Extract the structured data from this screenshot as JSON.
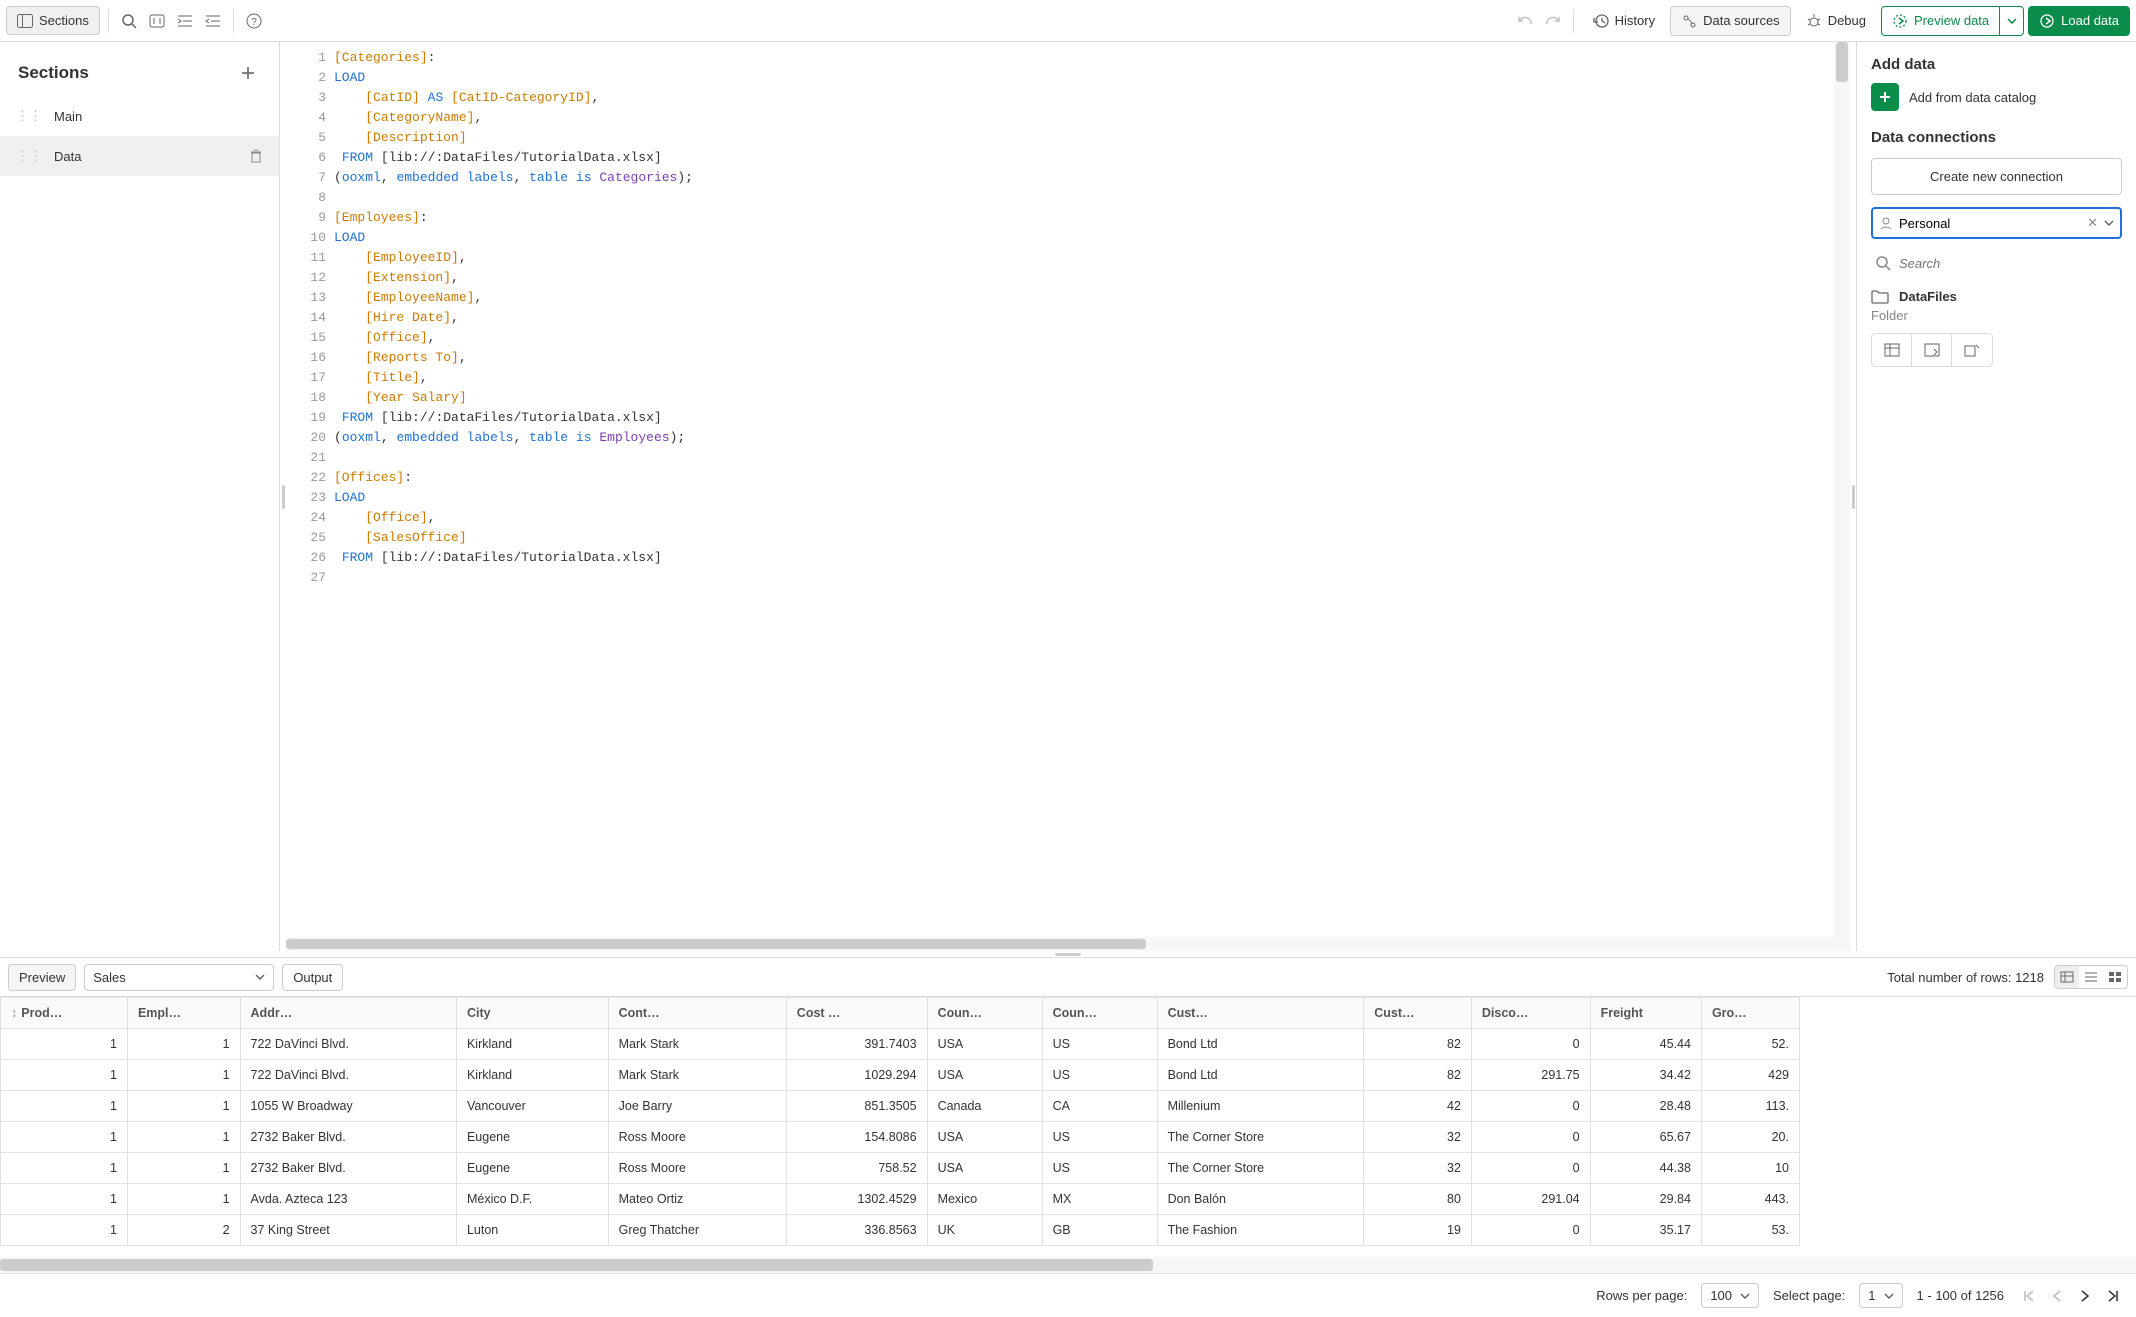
{
  "toolbar": {
    "sections_label": "Sections",
    "history_label": "History",
    "data_sources_label": "Data sources",
    "debug_label": "Debug",
    "preview_data_label": "Preview data",
    "load_data_label": "Load data"
  },
  "sidebar": {
    "title": "Sections",
    "items": [
      {
        "label": "Main",
        "active": false
      },
      {
        "label": "Data",
        "active": true
      }
    ]
  },
  "editor": {
    "lines": [
      {
        "n": 1,
        "segs": [
          [
            "[Categories]",
            "or"
          ],
          [
            ":",
            ""
          ]
        ]
      },
      {
        "n": 2,
        "segs": [
          [
            "LOAD",
            "bl"
          ]
        ]
      },
      {
        "n": 3,
        "segs": [
          [
            "    ",
            ""
          ],
          [
            "[CatID]",
            "or"
          ],
          [
            " ",
            ""
          ],
          [
            "AS",
            "bl"
          ],
          [
            " ",
            ""
          ],
          [
            "[CatID-CategoryID]",
            "or"
          ],
          [
            ",",
            ""
          ]
        ]
      },
      {
        "n": 4,
        "segs": [
          [
            "    ",
            ""
          ],
          [
            "[CategoryName]",
            "or"
          ],
          [
            ",",
            ""
          ]
        ]
      },
      {
        "n": 5,
        "segs": [
          [
            "    ",
            ""
          ],
          [
            "[Description]",
            "or"
          ]
        ]
      },
      {
        "n": 6,
        "segs": [
          [
            " ",
            ""
          ],
          [
            "FROM",
            "bl"
          ],
          [
            " [lib://:DataFiles/TutorialData.xlsx]",
            ""
          ]
        ]
      },
      {
        "n": 7,
        "segs": [
          [
            "(",
            ""
          ],
          [
            "ooxml",
            "bl"
          ],
          [
            ", ",
            ""
          ],
          [
            "embedded",
            "bl"
          ],
          [
            " ",
            ""
          ],
          [
            "labels",
            "bl"
          ],
          [
            ", ",
            ""
          ],
          [
            "table",
            "bl"
          ],
          [
            " ",
            ""
          ],
          [
            "is",
            "bl"
          ],
          [
            " ",
            ""
          ],
          [
            "Categories",
            "pu"
          ],
          [
            ");",
            ""
          ]
        ]
      },
      {
        "n": 8,
        "segs": [
          [
            "",
            ""
          ]
        ]
      },
      {
        "n": 9,
        "segs": [
          [
            "[Employees]",
            "or"
          ],
          [
            ":",
            ""
          ]
        ]
      },
      {
        "n": 10,
        "segs": [
          [
            "LOAD",
            "bl"
          ]
        ]
      },
      {
        "n": 11,
        "segs": [
          [
            "    ",
            ""
          ],
          [
            "[EmployeeID]",
            "or"
          ],
          [
            ",",
            ""
          ]
        ]
      },
      {
        "n": 12,
        "segs": [
          [
            "    ",
            ""
          ],
          [
            "[Extension]",
            "or"
          ],
          [
            ",",
            ""
          ]
        ]
      },
      {
        "n": 13,
        "segs": [
          [
            "    ",
            ""
          ],
          [
            "[EmployeeName]",
            "or"
          ],
          [
            ",",
            ""
          ]
        ]
      },
      {
        "n": 14,
        "segs": [
          [
            "    ",
            ""
          ],
          [
            "[Hire Date]",
            "or"
          ],
          [
            ",",
            ""
          ]
        ]
      },
      {
        "n": 15,
        "segs": [
          [
            "    ",
            ""
          ],
          [
            "[Office]",
            "or"
          ],
          [
            ",",
            ""
          ]
        ]
      },
      {
        "n": 16,
        "segs": [
          [
            "    ",
            ""
          ],
          [
            "[Reports To]",
            "or"
          ],
          [
            ",",
            ""
          ]
        ]
      },
      {
        "n": 17,
        "segs": [
          [
            "    ",
            ""
          ],
          [
            "[Title]",
            "or"
          ],
          [
            ",",
            ""
          ]
        ]
      },
      {
        "n": 18,
        "segs": [
          [
            "    ",
            ""
          ],
          [
            "[Year Salary]",
            "or"
          ]
        ]
      },
      {
        "n": 19,
        "segs": [
          [
            " ",
            ""
          ],
          [
            "FROM",
            "bl"
          ],
          [
            " [lib://:DataFiles/TutorialData.xlsx]",
            ""
          ]
        ]
      },
      {
        "n": 20,
        "segs": [
          [
            "(",
            ""
          ],
          [
            "ooxml",
            "bl"
          ],
          [
            ", ",
            ""
          ],
          [
            "embedded",
            "bl"
          ],
          [
            " ",
            ""
          ],
          [
            "labels",
            "bl"
          ],
          [
            ", ",
            ""
          ],
          [
            "table",
            "bl"
          ],
          [
            " ",
            ""
          ],
          [
            "is",
            "bl"
          ],
          [
            " ",
            ""
          ],
          [
            "Employees",
            "pu"
          ],
          [
            ");",
            ""
          ]
        ]
      },
      {
        "n": 21,
        "segs": [
          [
            "",
            ""
          ]
        ]
      },
      {
        "n": 22,
        "segs": [
          [
            "[Offices]",
            "or"
          ],
          [
            ":",
            ""
          ]
        ]
      },
      {
        "n": 23,
        "segs": [
          [
            "LOAD",
            "bl"
          ]
        ]
      },
      {
        "n": 24,
        "segs": [
          [
            "    ",
            ""
          ],
          [
            "[Office]",
            "or"
          ],
          [
            ",",
            ""
          ]
        ]
      },
      {
        "n": 25,
        "segs": [
          [
            "    ",
            ""
          ],
          [
            "[SalesOffice]",
            "or"
          ]
        ]
      },
      {
        "n": 26,
        "segs": [
          [
            " ",
            ""
          ],
          [
            "FROM",
            "bl"
          ],
          [
            " [lib://:DataFiles/TutorialData.xlsx]",
            ""
          ]
        ]
      },
      {
        "n": 27,
        "segs": [
          [
            "",
            ""
          ]
        ]
      }
    ]
  },
  "right": {
    "add_data_title": "Add data",
    "add_catalog_label": "Add from data catalog",
    "dc_title": "Data connections",
    "create_label": "Create new connection",
    "space_value": "Personal",
    "search_placeholder": "Search",
    "conn_name": "DataFiles",
    "conn_type": "Folder"
  },
  "preview": {
    "preview_label": "Preview",
    "output_label": "Output",
    "table_select": "Sales",
    "total_rows_label": "Total number of rows: 1218",
    "columns": [
      "Prod…",
      "Empl…",
      "Addr…",
      "City",
      "Cont…",
      "Cost …",
      "Coun…",
      "Coun…",
      "Cust…",
      "Cust…",
      "Disco…",
      "Freight",
      "Gro…"
    ],
    "rows": [
      [
        "1",
        "1",
        "722 DaVinci Blvd.",
        "Kirkland",
        "Mark Stark",
        "391.7403",
        "USA",
        "US",
        "Bond Ltd",
        "82",
        "0",
        "45.44",
        "52."
      ],
      [
        "1",
        "1",
        "722 DaVinci Blvd.",
        "Kirkland",
        "Mark Stark",
        "1029.294",
        "USA",
        "US",
        "Bond Ltd",
        "82",
        "291.75",
        "34.42",
        "429"
      ],
      [
        "1",
        "1",
        "1055 W Broadway",
        "Vancouver",
        "Joe Barry",
        "851.3505",
        "Canada",
        "CA",
        "Millenium",
        "42",
        "0",
        "28.48",
        "113."
      ],
      [
        "1",
        "1",
        "2732 Baker Blvd.",
        "Eugene",
        "Ross Moore",
        "154.8086",
        "USA",
        "US",
        "The Corner Store",
        "32",
        "0",
        "65.67",
        "20."
      ],
      [
        "1",
        "1",
        "2732 Baker Blvd.",
        "Eugene",
        "Ross Moore",
        "758.52",
        "USA",
        "US",
        "The Corner Store",
        "32",
        "0",
        "44.38",
        "10"
      ],
      [
        "1",
        "1",
        "Avda. Azteca 123",
        "México D.F.",
        "Mateo Ortiz",
        "1302.4529",
        "Mexico",
        "MX",
        "Don Balón",
        "80",
        "291.04",
        "29.84",
        "443."
      ],
      [
        "1",
        "2",
        "37 King Street",
        "Luton",
        "Greg Thatcher",
        "336.8563",
        "UK",
        "GB",
        "The Fashion",
        "19",
        "0",
        "35.17",
        "53."
      ]
    ],
    "numeric_cols": [
      0,
      1,
      5,
      9,
      10,
      11,
      12
    ]
  },
  "footer": {
    "rows_label": "Rows per page:",
    "rows_value": "100",
    "page_label": "Select page:",
    "page_value": "1",
    "range_label": "1 - 100 of 1256"
  }
}
